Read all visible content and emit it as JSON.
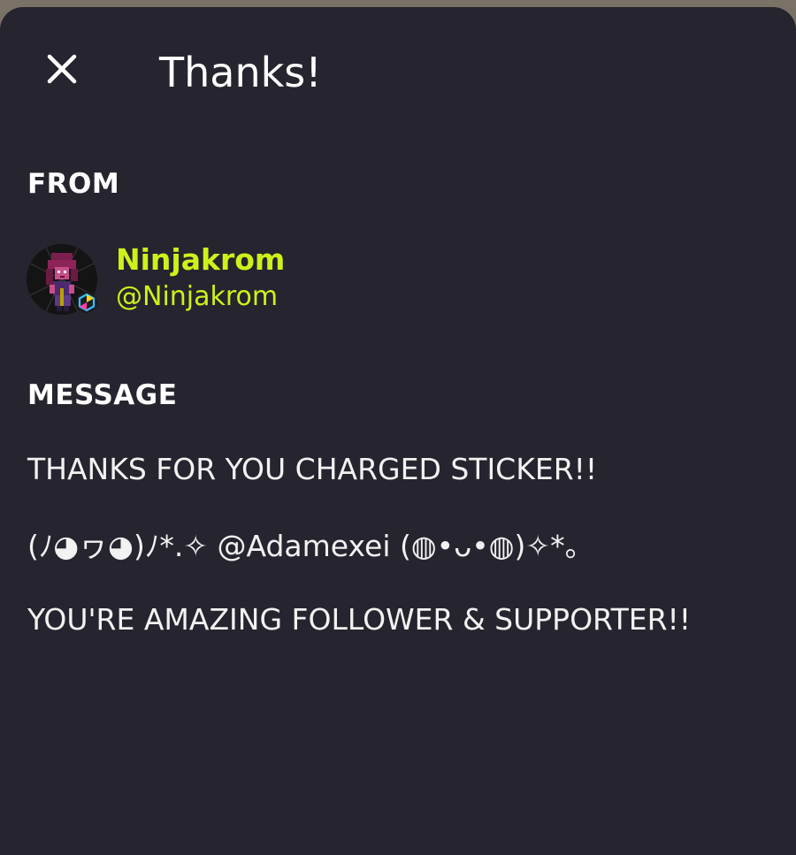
{
  "header": {
    "title": "Thanks!",
    "close_icon": "close-icon"
  },
  "from": {
    "label": "FROM",
    "name": "Ninjakrom",
    "handle": "@Ninjakrom",
    "avatar": "pixel-art-avatar",
    "name_color": "#ccf21a"
  },
  "message": {
    "label": "MESSAGE",
    "lines": [
      "THANKS FOR YOU CHARGED STICKER!!",
      "(ﾉ◕ヮ◕)ﾉ*.✧ @Adamexei (◍•ᴗ•◍)✧*。",
      "YOU'RE AMAZING FOLLOWER & SUPPORTER!!"
    ]
  },
  "colors": {
    "sheet_background": "#26242e",
    "accent": "#ccf21a",
    "text": "#ffffff"
  }
}
